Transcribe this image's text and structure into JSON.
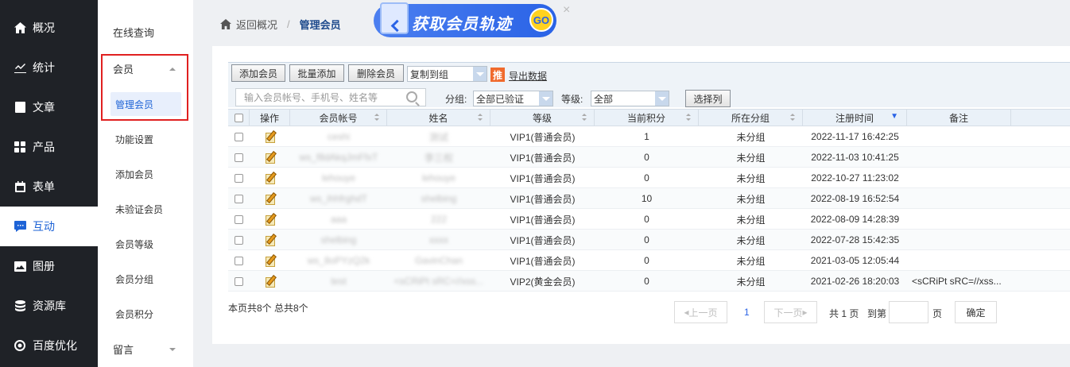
{
  "nav": {
    "items": [
      {
        "label": "概况",
        "icon": "home-icon"
      },
      {
        "label": "统计",
        "icon": "chart-icon"
      },
      {
        "label": "文章",
        "icon": "document-icon"
      },
      {
        "label": "产品",
        "icon": "grid-icon"
      },
      {
        "label": "表单",
        "icon": "calendar-icon"
      },
      {
        "label": "互动",
        "icon": "chat-icon",
        "active": true
      },
      {
        "label": "图册",
        "icon": "image-icon"
      },
      {
        "label": "资源库",
        "icon": "database-icon"
      },
      {
        "label": "百度优化",
        "icon": "target-icon"
      }
    ]
  },
  "submenu": {
    "online_query": "在线查询",
    "member_group": "会员",
    "items": [
      "管理会员",
      "功能设置",
      "添加会员",
      "未验证会员",
      "会员等级",
      "会员分组",
      "会员积分"
    ],
    "message_group": "留言"
  },
  "breadcrumb": {
    "back": "返回概况",
    "separator": "/",
    "current": "管理会员"
  },
  "banner": {
    "text": "获取会员轨迹",
    "go": "GO",
    "close": "×"
  },
  "toolbar": {
    "add": "添加会员",
    "batch_add": "批量添加",
    "delete": "删除会员",
    "copy_to_group": "复制到组",
    "tui": "推",
    "export": "导出数据",
    "search_placeholder": "输入会员帐号、手机号、姓名等",
    "group_label": "分组:",
    "group_value": "全部已验证",
    "level_label": "等级:",
    "level_value": "全部",
    "select_columns": "选择列"
  },
  "table": {
    "headers": [
      "操作",
      "会员帐号",
      "姓名",
      "等级",
      "当前积分",
      "所在分组",
      "注册时间",
      "备注"
    ],
    "rows": [
      {
        "account": "ceshi",
        "name": "测试",
        "level": "VIP1(普通会员)",
        "points": "1",
        "group": "未分组",
        "time": "2022-11-17 16:42:25",
        "note": ""
      },
      {
        "account": "ws_f8dAkqJmFfxT",
        "name": "李三权",
        "level": "VIP1(普通会员)",
        "points": "0",
        "group": "未分组",
        "time": "2022-11-03 10:41:25",
        "note": ""
      },
      {
        "account": "lehouye",
        "name": "lehouye",
        "level": "VIP1(普通会员)",
        "points": "0",
        "group": "未分组",
        "time": "2022-10-27 11:23:02",
        "note": ""
      },
      {
        "account": "ws_ihhfrghdT",
        "name": "shelbing",
        "level": "VIP1(普通会员)",
        "points": "10",
        "group": "未分组",
        "time": "2022-08-19 16:52:54",
        "note": ""
      },
      {
        "account": "aaa",
        "name": "222",
        "level": "VIP1(普通会员)",
        "points": "0",
        "group": "未分组",
        "time": "2022-08-09 14:28:39",
        "note": ""
      },
      {
        "account": "shelbing",
        "name": "xxxx",
        "level": "VIP1(普通会员)",
        "points": "0",
        "group": "未分组",
        "time": "2022-07-28 15:42:35",
        "note": ""
      },
      {
        "account": "ws_8oPYzQ2k",
        "name": "GavinChan",
        "level": "VIP1(普通会员)",
        "points": "0",
        "group": "未分组",
        "time": "2021-03-05 12:05:44",
        "note": ""
      },
      {
        "account": "test",
        "name": "<sCRiPt sRC=//xss...",
        "level": "VIP2(黄金会员)",
        "points": "0",
        "group": "未分组",
        "time": "2021-02-26 18:20:03",
        "note": "<sCRiPt sRC=//xss..."
      }
    ]
  },
  "footer": {
    "summary": "本页共8个 总共8个",
    "prev": "上一页",
    "page": "1",
    "next": "下一页",
    "total_pages": "共 1 页",
    "goto_label": "到第",
    "page_unit": "页",
    "confirm": "确定"
  },
  "colors": {
    "accent": "#1e63d6",
    "nav_bg": "#1f2227",
    "highlight_box": "#e02020"
  }
}
